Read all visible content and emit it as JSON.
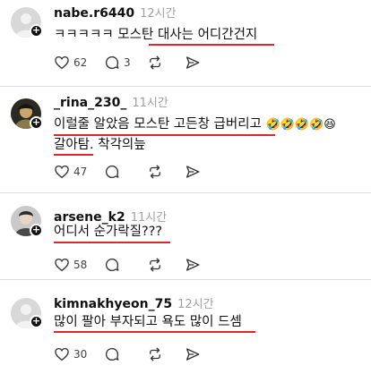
{
  "posts": [
    {
      "username": "nabe.r6440",
      "time": "12시간",
      "lines": [
        "ㅋㅋㅋㅋㅋ 모스탄 대사는 어디간건지"
      ],
      "likes": "62",
      "replies": "3",
      "emojis": ""
    },
    {
      "username": "_rina_230_",
      "time": "11시간",
      "lines": [
        "이럴줄 알았음 모스탄 고든창 급버리고",
        "갈아탐. 착각의늪"
      ],
      "likes": "47",
      "replies": "",
      "emojis": "🤣🤣🤣🤣😆"
    },
    {
      "username": "arsene_k2",
      "time": "11시간",
      "lines": [
        "어디서 순가락질???"
      ],
      "likes": "58",
      "replies": "",
      "emojis": ""
    },
    {
      "username": "kimnakhyeon_75",
      "time": "12시간",
      "lines": [
        "많이 팔아 부자되고 욕도 많이 드셈"
      ],
      "likes": "30",
      "replies": "",
      "emojis": ""
    }
  ],
  "icons": [
    "avatar-icon",
    "plus-icon",
    "heart-icon",
    "reply-icon",
    "repost-icon",
    "share-icon"
  ],
  "colors": {
    "underline": "#e0262b",
    "time": "#a0a0a0",
    "divider": "#dedede"
  }
}
